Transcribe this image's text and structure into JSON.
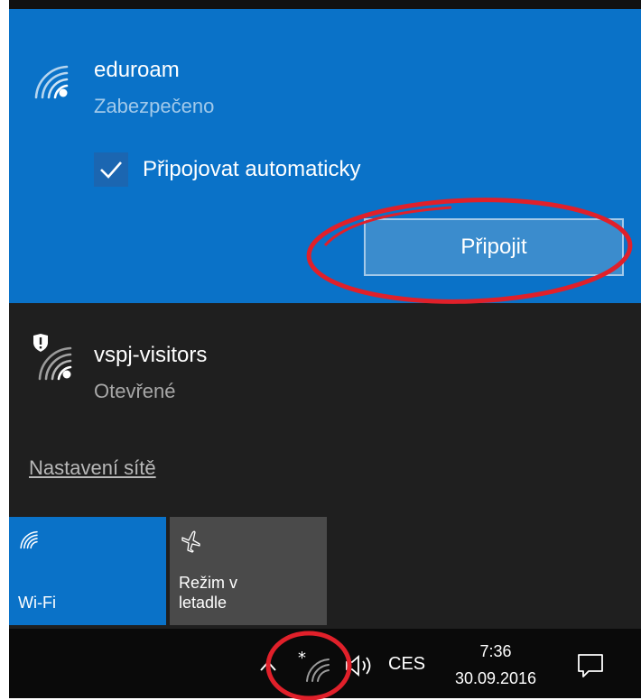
{
  "selected_network": {
    "name": "eduroam",
    "status": "Zabezpečeno",
    "auto_connect_label": "Připojovat automaticky",
    "auto_connect_checked": true,
    "connect_label": "Připojit"
  },
  "other_network": {
    "name": "vspj-visitors",
    "status": "Otevřené"
  },
  "settings_link": "Nastavení sítě",
  "tiles": {
    "wifi_label": "Wi-Fi",
    "airplane_label_line1": "Režim v",
    "airplane_label_line2": "letadle"
  },
  "taskbar": {
    "language": "CES",
    "time": "7:36",
    "date": "30.09.2016"
  },
  "colors": {
    "accent": "#0a72c8",
    "background": "#1f1f1f",
    "annotation": "#e0202a"
  }
}
